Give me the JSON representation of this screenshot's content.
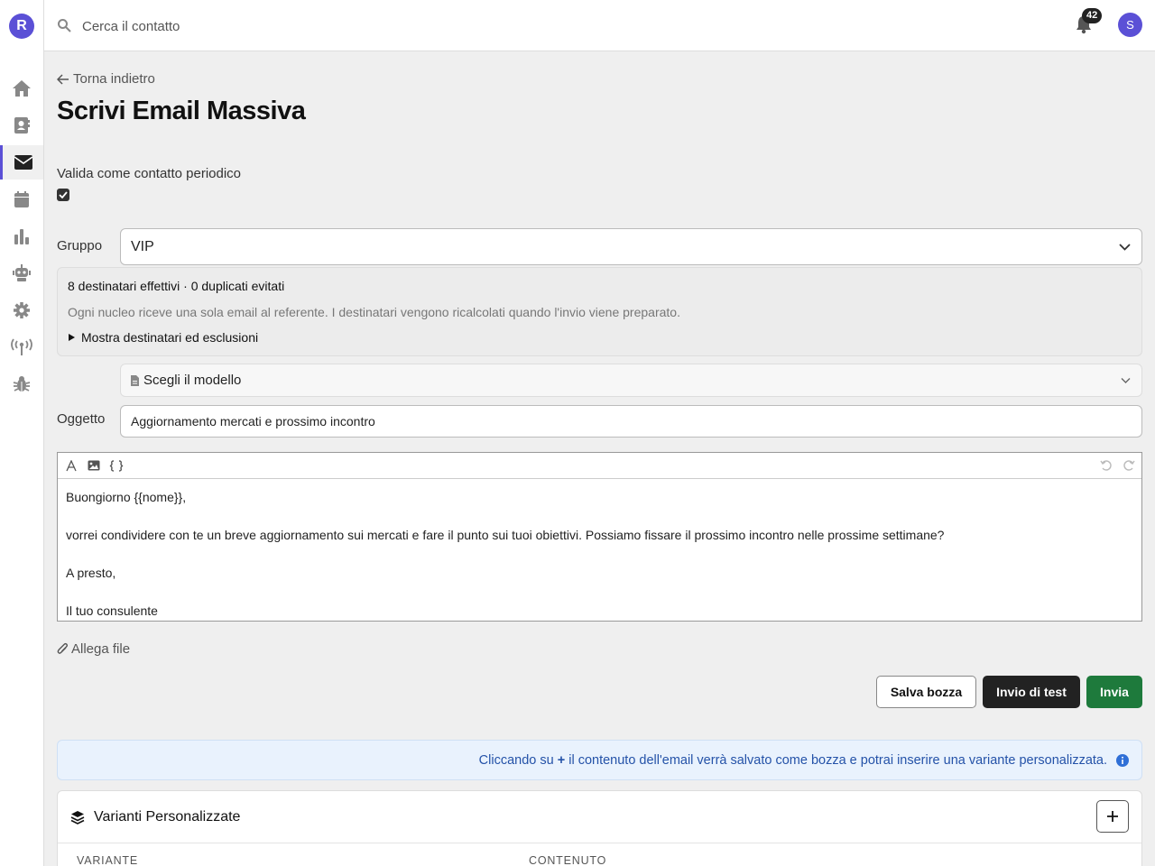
{
  "brand": {
    "logo": "R",
    "accent": "#5b50d6"
  },
  "topbar": {
    "search_placeholder": "Cerca il contatto",
    "search_icon": "search-icon",
    "notifications_count": "42",
    "avatar_initial": "S"
  },
  "sidebar": {
    "items": [
      {
        "name": "home",
        "icon": "home-icon"
      },
      {
        "name": "contacts",
        "icon": "contacts-icon"
      },
      {
        "name": "email",
        "icon": "envelope-icon",
        "active": true
      },
      {
        "name": "calendar",
        "icon": "calendar-icon"
      },
      {
        "name": "stats",
        "icon": "bar-chart-icon"
      },
      {
        "name": "bot",
        "icon": "robot-icon"
      },
      {
        "name": "settings",
        "icon": "gear-icon"
      },
      {
        "name": "broadcast",
        "icon": "antenna-icon"
      },
      {
        "name": "debug",
        "icon": "bug-icon"
      }
    ]
  },
  "page": {
    "back_label": "Torna indietro",
    "title": "Scrivi Email Massiva",
    "periodic_label": "Valida come contatto periodico",
    "periodic_checked": true
  },
  "form": {
    "group_label": "Gruppo",
    "group_value": "VIP",
    "recipients_summary": "8 destinatari effettivi · 0 duplicati evitati",
    "recipients_note": "Ogni nucleo riceve una sola email al referente. I destinatari vengono ricalcolati quando l'invio viene preparato.",
    "recipients_toggle": "Mostra destinatari ed esclusioni",
    "template_placeholder": "Scegli il modello",
    "subject_label": "Oggetto",
    "subject_value": "Aggiornamento mercati e prossimo incontro"
  },
  "editor": {
    "lines": [
      "Buongiorno {{nome}},",
      "vorrei condividere con te un breve aggiornamento sui mercati e fare il punto sui tuoi obiettivi. Possiamo fissare il prossimo incontro nelle prossime settimane?",
      "A presto,",
      "Il tuo consulente"
    ]
  },
  "actions": {
    "attach_label": "Allega file",
    "save_draft": "Salva bozza",
    "test_send": "Invio di test",
    "send": "Invia",
    "send_color": "#1e7a3c"
  },
  "alert": {
    "text_before": "Cliccando su",
    "plus": "+",
    "text_after": "il contenuto dell'email verrà salvato come bozza e potrai inserire una variante personalizzata."
  },
  "variants": {
    "title": "Varianti Personalizzate",
    "col_variant": "VARIANTE",
    "col_content": "CONTENUTO"
  }
}
